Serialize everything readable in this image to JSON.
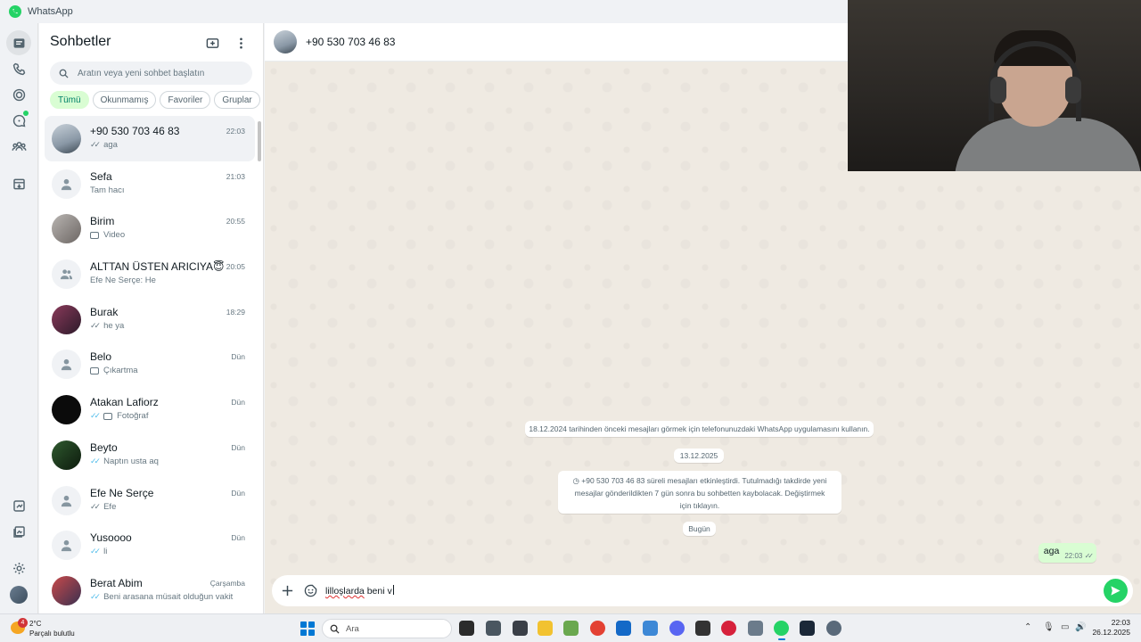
{
  "window": {
    "title": "WhatsApp"
  },
  "rail": {
    "items": [
      {
        "name": "chats",
        "icon": "chats-icon"
      },
      {
        "name": "calls",
        "icon": "phone-icon"
      },
      {
        "name": "status",
        "icon": "status-icon"
      },
      {
        "name": "channels",
        "icon": "channels-icon"
      },
      {
        "name": "communities",
        "icon": "communities-icon"
      },
      {
        "name": "archived",
        "icon": "archive-icon"
      },
      {
        "name": "starred-media",
        "icon": "starred-icon"
      },
      {
        "name": "media",
        "icon": "media-icon"
      },
      {
        "name": "settings",
        "icon": "settings-icon"
      }
    ]
  },
  "sidebar": {
    "title": "Sohbetler",
    "search_placeholder": "Aratın veya yeni sohbet başlatın",
    "filters": [
      "Tümü",
      "Okunmamış",
      "Favoriler",
      "Gruplar"
    ],
    "active_filter": "Tümü",
    "chats": [
      {
        "name": "+90 530 703 46 83",
        "time": "22:03",
        "preview": "aga",
        "tick": "✓✓",
        "tick_read": false
      },
      {
        "name": "Sefa",
        "time": "21:03",
        "preview": "Tam hacı",
        "tick": "",
        "tick_read": false
      },
      {
        "name": "Birim",
        "time": "20:55",
        "preview": "Video",
        "tick": "",
        "tick_read": false
      },
      {
        "name": "ALTTAN ÜSTEN ARICIYA😇",
        "time": "20:05",
        "preview": "Efe Ne Serçe: He",
        "tick": "",
        "tick_read": false
      },
      {
        "name": "Burak",
        "time": "18:29",
        "preview": "he ya",
        "tick": "✓✓",
        "tick_read": false
      },
      {
        "name": "Belo",
        "time": "Dün",
        "preview": "Çıkartma",
        "tick": "",
        "tick_read": false
      },
      {
        "name": "Atakan Lafiorz",
        "time": "Dün",
        "preview": "Fotoğraf",
        "tick": "✓✓",
        "tick_read": true
      },
      {
        "name": "Beyto",
        "time": "Dün",
        "preview": "Naptın usta aq",
        "tick": "✓✓",
        "tick_read": true
      },
      {
        "name": "Efe Ne Serçe",
        "time": "Dün",
        "preview": "Efe",
        "tick": "✓✓",
        "tick_read": false
      },
      {
        "name": "Yusoooo",
        "time": "Dün",
        "preview": "li",
        "tick": "✓✓",
        "tick_read": true
      },
      {
        "name": "Berat Abim",
        "time": "Çarşamba",
        "preview": "Beni arasana müsait olduğun vakit",
        "tick": "✓✓",
        "tick_read": true
      }
    ]
  },
  "conversation": {
    "title": "+90 530 703 46 83",
    "system_message_1": "18.12.2024 tarihinden önceki mesajları görmek için telefonunuzdaki WhatsApp uygulamasını kullanın.",
    "date_1": "13.12.2025",
    "system_message_2": "+90 530 703 46 83 süreli mesajları etkinleştirdi. Tutulmadığı takdirde yeni mesajlar gönderildikten 7 gün sonra bu sohbetten kaybolacak. Değiştirmek için tıklayın.",
    "date_2": "Bugün",
    "message": {
      "text": "aga",
      "time": "22:03",
      "tick": "✓✓"
    },
    "composer": {
      "misspelled": "lilloşlarda",
      "rest": " beni v"
    }
  },
  "taskbar": {
    "weather_badge": "4",
    "weather_temp": "2°C",
    "weather_desc": "Parçalı bulutlu",
    "search_label": "Ara",
    "clock_time": "22:03",
    "clock_date": "26.12.2025"
  },
  "colors": {
    "accent": "#25d366",
    "selected_chip": "#d9fdd3",
    "outgoing_bubble": "#d9fdd3",
    "read_tick": "#53bdeb"
  }
}
